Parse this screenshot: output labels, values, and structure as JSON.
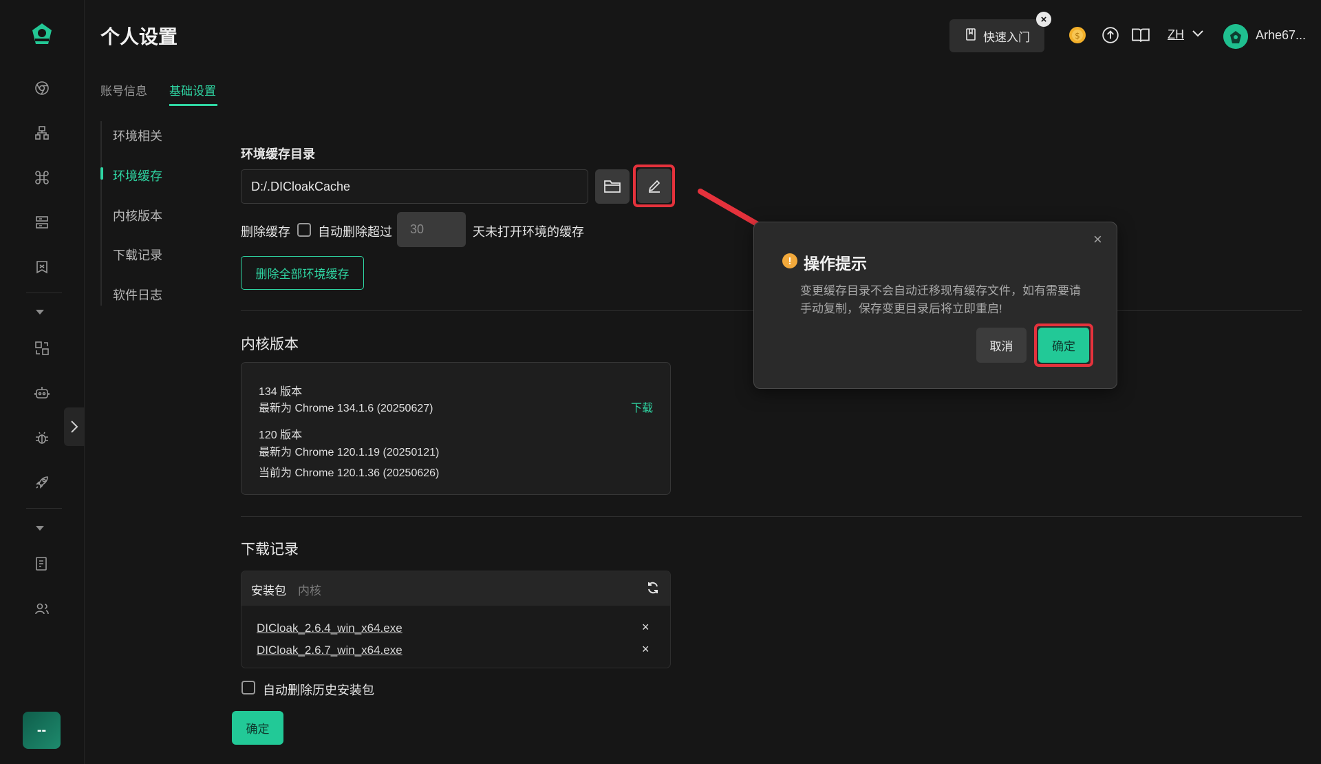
{
  "header": {
    "page_title": "个人设置",
    "tabs": [
      {
        "label": "账号信息",
        "active": false
      },
      {
        "label": "基础设置",
        "active": true
      }
    ],
    "quick_start_label": "快速入门",
    "language": "ZH",
    "username": "Arhe67..."
  },
  "sidebar": {
    "icons": [
      "logo-icon",
      "browser-icon",
      "sitemap-icon",
      "command-icon",
      "server-icon",
      "script-icon",
      "expand-icon",
      "sync-icon",
      "robot-icon",
      "bug-icon",
      "rocket-icon",
      "expand-icon",
      "tasks-icon",
      "team-icon"
    ],
    "user_tile_label": "--"
  },
  "subnav": {
    "items": [
      {
        "label": "环境相关",
        "active": false
      },
      {
        "label": "环境缓存",
        "active": true
      },
      {
        "label": "内核版本",
        "active": false
      },
      {
        "label": "下载记录",
        "active": false
      },
      {
        "label": "软件日志",
        "active": false
      }
    ]
  },
  "cache": {
    "dir_label": "环境缓存目录",
    "dir_value": "D:/.DICloakCache",
    "delete_label": "删除缓存",
    "auto_delete_label": "自动删除超过",
    "days_value": "30",
    "days_suffix": "天未打开环境的缓存",
    "delete_all_label": "删除全部环境缓存"
  },
  "kernel": {
    "title": "内核版本",
    "v134_label": "134 版本",
    "v134_latest": "最新为 Chrome 134.1.6 (20250627)",
    "download_label": "下载",
    "v120_label": "120 版本",
    "v120_latest": "最新为 Chrome 120.1.19 (20250121)",
    "v120_current": "当前为 Chrome 120.1.36 (20250626)"
  },
  "downloads": {
    "title": "下载记录",
    "tabs": [
      {
        "label": "安装包",
        "active": true
      },
      {
        "label": "内核",
        "active": false
      }
    ],
    "files": [
      "DICloak_2.6.4_win_x64.exe",
      "DICloak_2.6.7_win_x64.exe"
    ],
    "remove_symbol": "×",
    "auto_delete_label": "自动删除历史安装包"
  },
  "confirm_label": "确定",
  "dialog": {
    "title": "操作提示",
    "warn_symbol": "!",
    "message": "变更缓存目录不会自动迁移现有缓存文件，如有需要请手动复制，保存变更目录后将立即重启!",
    "close_symbol": "×",
    "cancel_label": "取消",
    "ok_label": "确定"
  },
  "colors": {
    "accent": "#2fd6a3",
    "highlight": "#e5323c",
    "warning": "#f2a93b",
    "background": "#161616"
  }
}
